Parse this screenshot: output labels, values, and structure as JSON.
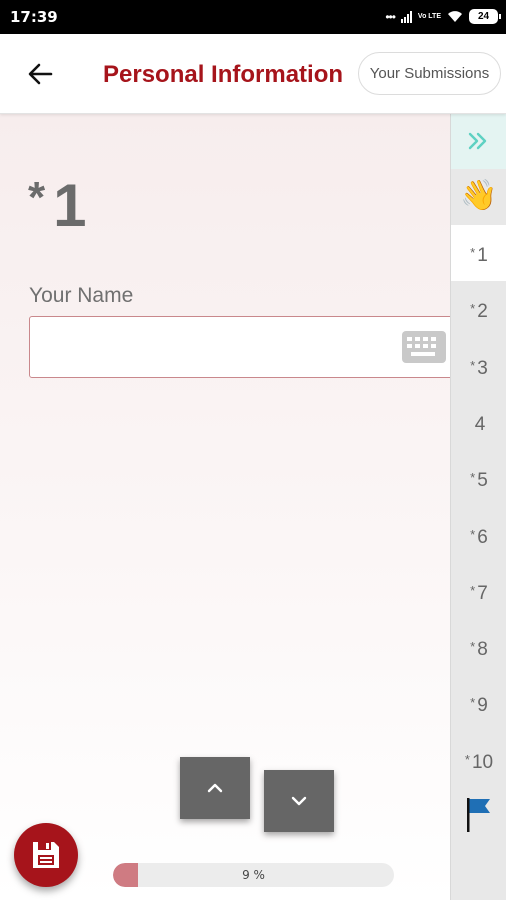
{
  "status_bar": {
    "time": "17:39",
    "network": "Vo LTE",
    "battery": "24"
  },
  "header": {
    "title": "Personal Information",
    "submissions_label": "Your Submissions"
  },
  "question": {
    "required_marker": "*",
    "number": "1",
    "label": "Your Name",
    "value": ""
  },
  "progress": {
    "percent": 9,
    "label": "9 %"
  },
  "side_nav": {
    "wave_icon": "waving-hand",
    "items": [
      {
        "marker": "*",
        "label": "1",
        "active": true
      },
      {
        "marker": "*",
        "label": "2"
      },
      {
        "marker": "*",
        "label": "3"
      },
      {
        "marker": "",
        "label": "4"
      },
      {
        "marker": "*",
        "label": "5"
      },
      {
        "marker": "*",
        "label": "6"
      },
      {
        "marker": "*",
        "label": "7"
      },
      {
        "marker": "*",
        "label": "8"
      },
      {
        "marker": "*",
        "label": "9"
      },
      {
        "marker": "*",
        "label": "10"
      }
    ]
  },
  "colors": {
    "brand": "#a6141b",
    "progress_fill": "#cf7b82",
    "flag": "#1f6fb5",
    "expand": "#5ed1c2"
  }
}
